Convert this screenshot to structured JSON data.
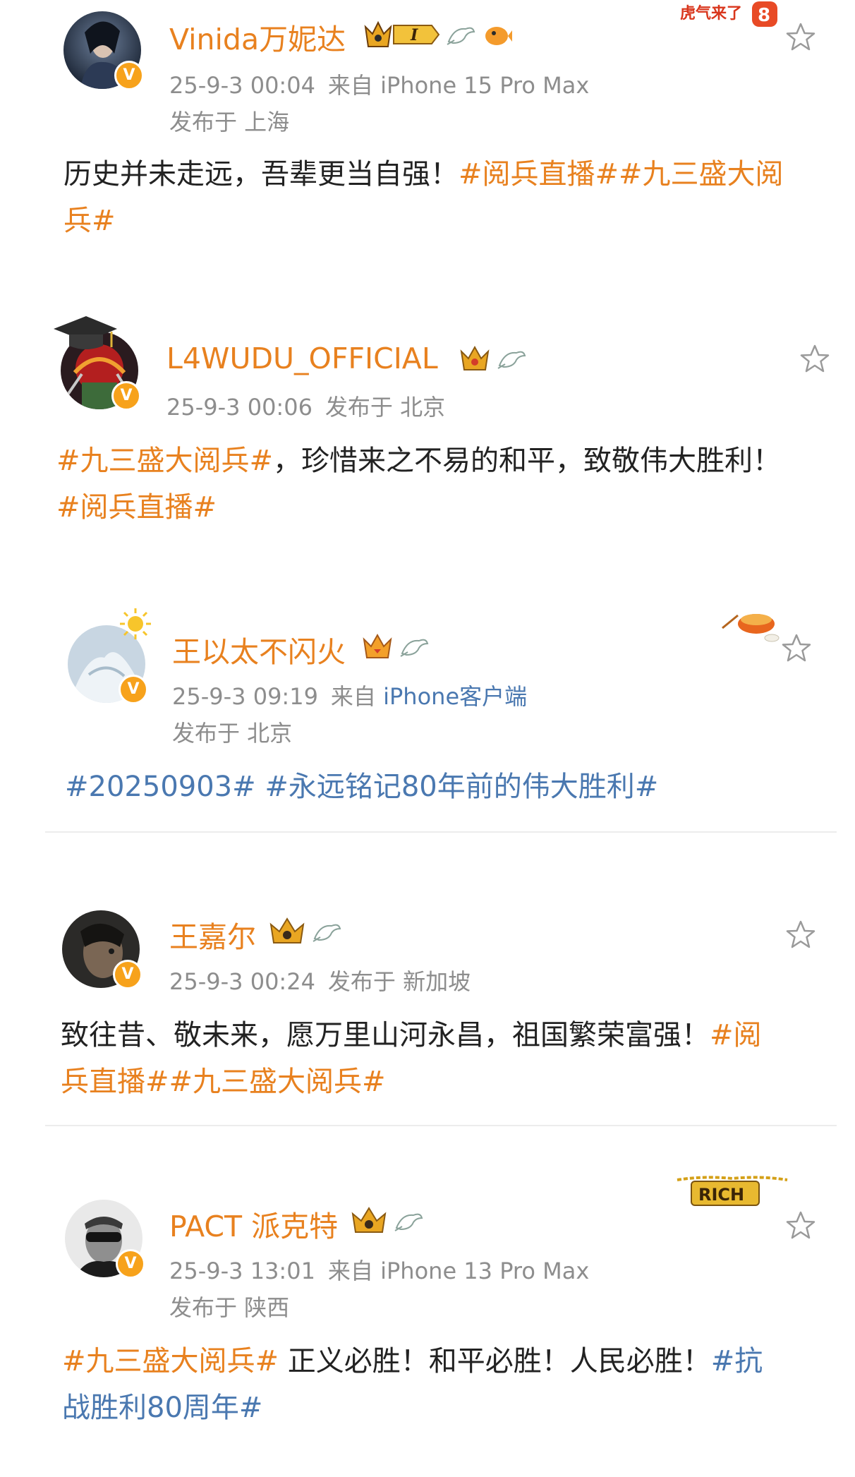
{
  "posts": [
    {
      "name": "Vinida万妮达",
      "time": "25-9-3 00:04",
      "source_prefix": "来自",
      "source": "iPhone 15 Pro Max",
      "location": "发布于 上海",
      "content": {
        "line1_text": "历史并未走远，吾辈更当自强！",
        "line1_tag": "#阅兵直播##九三盛大阅",
        "line2_tag": "兵#"
      },
      "decoration_text": "虎气来了",
      "level_badge": "I"
    },
    {
      "name": "L4WUDU_OFFICIAL",
      "time": "25-9-3 00:06",
      "location": "发布于 北京",
      "content": {
        "line1_tag": "#九三盛大阅兵#",
        "line1_text": "，珍惜来之不易的和平，致敬伟大胜利！",
        "line2_tag": "#阅兵直播#"
      }
    },
    {
      "name": "王以太不闪火",
      "time": "25-9-3 09:19",
      "source_prefix": "来自",
      "source": "iPhone客户端",
      "location": "发布于 北京",
      "content": {
        "line1_tag_a": "#20250903#",
        "line1_tag_b": "#永远铭记80年前的伟大胜利#"
      }
    },
    {
      "name": "王嘉尔",
      "time": "25-9-3 00:24",
      "location": "发布于 新加坡",
      "content": {
        "line1_text": "致往昔、敬未来，愿万里山河永昌，祖国繁荣富强！",
        "line1_tag": "#阅",
        "line2_tag": "兵直播##九三盛大阅兵#"
      }
    },
    {
      "name": "PACT 派克特",
      "time": "25-9-3 13:01",
      "source_prefix": "来自",
      "source": "iPhone 13 Pro Max",
      "location": "发布于 陕西",
      "content": {
        "line1_tag": "#九三盛大阅兵#",
        "line1_text": " 正义必胜！和平必胜！人民必胜！",
        "line1_tag_blue": "#抗",
        "line2_tag_blue": "战胜利80周年#"
      },
      "decoration_text": "RICH"
    }
  ],
  "icons": {
    "star": "star-icon",
    "verified": "verified-badge-icon",
    "crown": "crown-icon",
    "dove": "dove-icon"
  },
  "colors": {
    "name_orange": "#e8811f",
    "topic_blue": "#4a78b0",
    "meta_gray": "#8d8d8d",
    "verified_orange": "#f7a21b"
  }
}
